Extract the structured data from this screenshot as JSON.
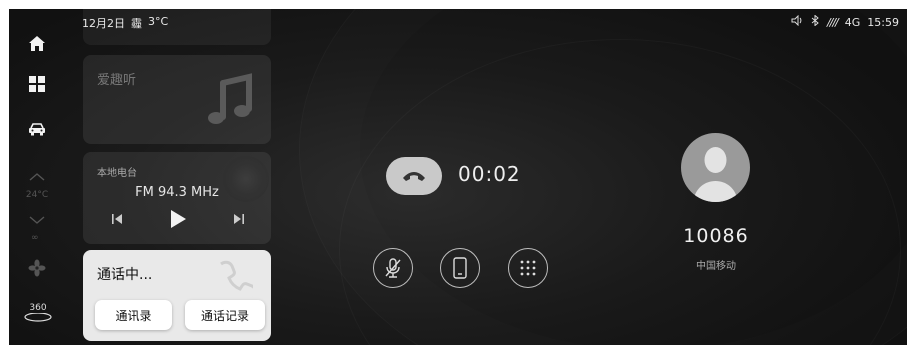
{
  "status_bar": {
    "date": "12月2日",
    "weather_icon": "霾",
    "temperature": "3°C",
    "signal": "////",
    "network": "4G",
    "time": "15:59"
  },
  "rail": {
    "temperature": "24°C",
    "fan_mode": "∞",
    "btn_360": "360"
  },
  "music_card": {
    "title": "爱趣听"
  },
  "radio_card": {
    "label": "本地电台",
    "frequency": "FM 94.3 MHz"
  },
  "call_card": {
    "status": "通话中...",
    "contacts_label": "通讯录",
    "history_label": "通话记录"
  },
  "call": {
    "duration": "00:02",
    "number": "10086",
    "carrier": "中国移动"
  },
  "icons": {
    "home": "home-icon",
    "apps": "apps-icon",
    "car": "car-icon",
    "fan": "fan-icon",
    "hangup": "phone-hangup-icon",
    "mute": "mic-off-icon",
    "handset": "phone-device-icon",
    "keypad": "dialpad-icon"
  }
}
